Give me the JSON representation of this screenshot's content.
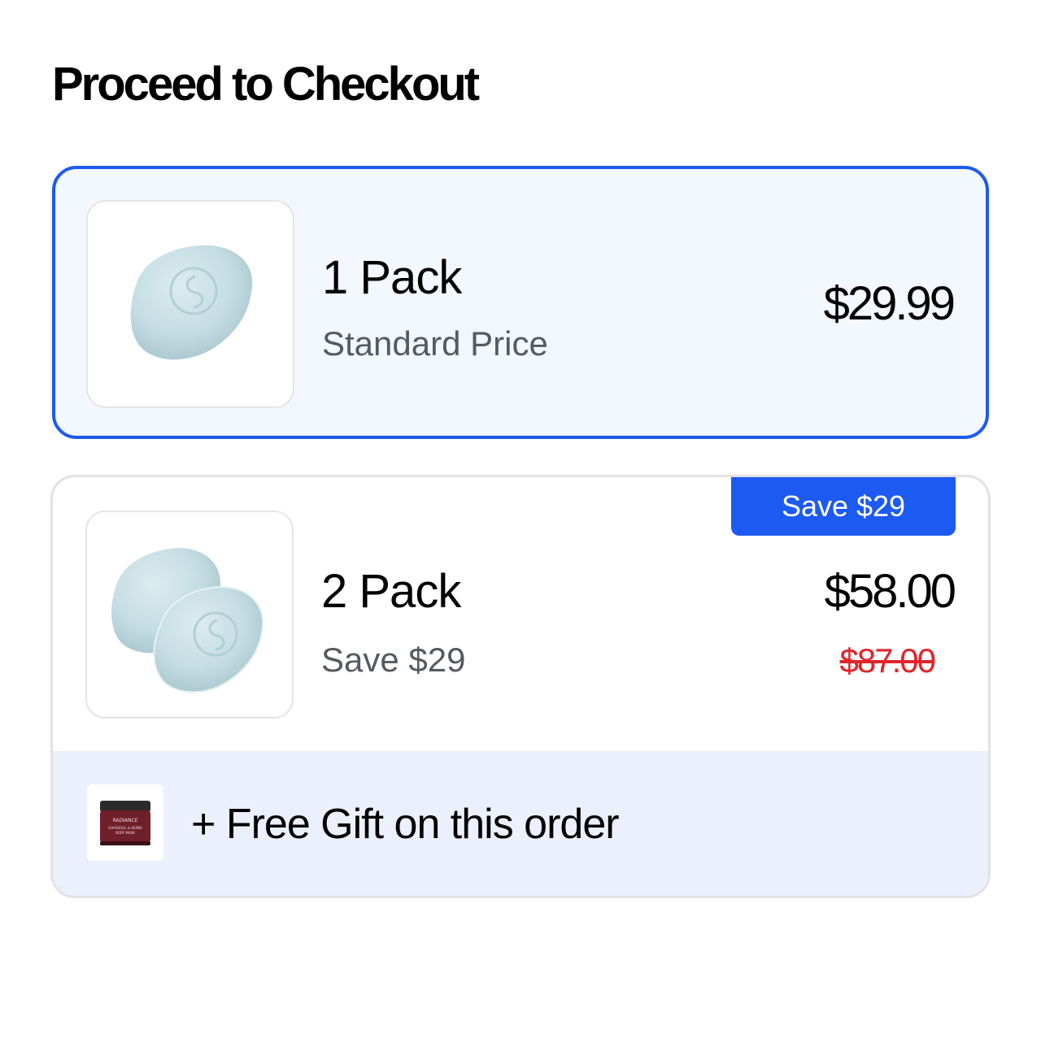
{
  "page": {
    "title": "Proceed to Checkout"
  },
  "options": [
    {
      "name": "1 Pack",
      "subtitle": "Standard Price",
      "price": "$29.99",
      "selected": true,
      "image_icon": "soap-bar-icon"
    },
    {
      "name": "2 Pack",
      "subtitle": "Save $29",
      "price": "$58.00",
      "original_price": "$87.00",
      "badge": "Save $29",
      "selected": false,
      "image_icon": "soap-bars-pair-icon",
      "gift": {
        "label": "+ Free Gift on this order",
        "image_icon": "body-mask-jar-icon",
        "jar_brand": "RADIANCE",
        "jar_line1": "GHASSOUL & HERBS",
        "jar_line2": "BODY MASK"
      }
    }
  ],
  "colors": {
    "accent": "#1d5af2",
    "selected_bg": "#f3f7fe",
    "gift_bg": "#ebf0fd",
    "strike_price": "#e0252b",
    "soap": "#c8e0e6"
  }
}
